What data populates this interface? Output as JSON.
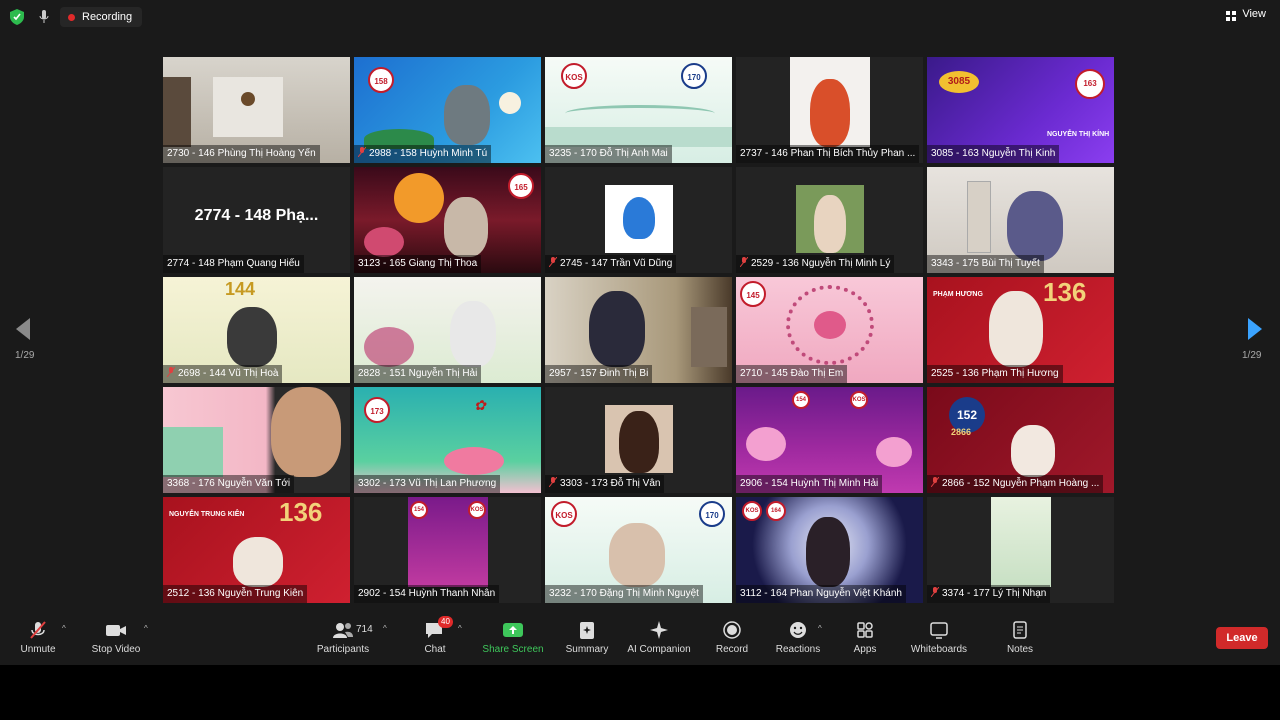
{
  "topbar": {
    "recording": "Recording",
    "view": "View"
  },
  "pager": {
    "left": "1/29",
    "right": "1/29"
  },
  "tiles": [
    {
      "label": "2730 - 146 Phùng Thị Hoàng Yến",
      "muted": false
    },
    {
      "label": "2988 - 158 Huỳnh Minh Tú",
      "muted": true
    },
    {
      "label": "3235 - 170 Đỗ Thị Anh Mai",
      "muted": false
    },
    {
      "label": "2737 - 146 Phan Thị Bích Thủy Phan ...",
      "muted": false
    },
    {
      "label": "3085 - 163 Nguyễn Thị Kinh",
      "muted": false
    },
    {
      "label": "2774 - 148 Phạm Quang Hiếu",
      "muted": false,
      "big": "2774 - 148 Phạ..."
    },
    {
      "label": "3123 - 165 Giang Thị Thoa",
      "muted": false
    },
    {
      "label": "2745 - 147 Trần Vũ Dũng",
      "muted": true
    },
    {
      "label": "2529 - 136 Nguyễn Thị Minh Lý",
      "muted": true
    },
    {
      "label": "3343 - 175 Bùi Thị Tuyết",
      "muted": false
    },
    {
      "label": "2698 - 144 Vũ Thị Hoà",
      "muted": true
    },
    {
      "label": "2828 - 151 Nguyễn Thị Hải",
      "muted": false
    },
    {
      "label": "2957 - 157 Đinh Thị Bi",
      "muted": false
    },
    {
      "label": "2710 - 145 Đào Thị Em",
      "muted": false
    },
    {
      "label": "2525 - 136 Phạm Thị Hương",
      "muted": false,
      "active": true
    },
    {
      "label": "3368 - 176 Nguyễn Văn Tới",
      "muted": false
    },
    {
      "label": "3302 - 173 Vũ Thị Lan Phương",
      "muted": false
    },
    {
      "label": "3303 - 173 Đỗ Thị Vân",
      "muted": true
    },
    {
      "label": "2906 - 154 Huỳnh Thị Minh Hải",
      "muted": false
    },
    {
      "label": "2866 - 152 Nguyễn Phạm Hoàng ...",
      "muted": true
    },
    {
      "label": "2512 - 136 Nguyễn Trung Kiên",
      "muted": false
    },
    {
      "label": "2902 - 154 Huỳnh Thanh Nhân",
      "muted": false
    },
    {
      "label": "3232 - 170 Đặng Thị Minh Nguyệt",
      "muted": false
    },
    {
      "label": "3112 - 164 Phan Nguyễn Việt Khánh",
      "muted": false
    },
    {
      "label": "3374 - 177 Lý Thị Nhạn",
      "muted": true
    }
  ],
  "tile_texts": {
    "t4_badge": "3085",
    "t4_badge2": "163",
    "t5_name": "NGUYỄN THỊ KÍNH",
    "t10_a": "144",
    "t14_a": "136",
    "t14_tag": "PHẠM HƯƠNG",
    "t19_a": "152",
    "t19_b": "2866",
    "t20_tag": "NGUYỄN TRUNG KIÊN",
    "t20_a": "136",
    "badge_158": "158",
    "badge_170": "170",
    "badge_165": "165",
    "badge_173": "173",
    "badge_145": "145",
    "badge_154": "154",
    "badge_164": "164",
    "kos": "KOS"
  },
  "toolbar": {
    "unmute": "Unmute",
    "stop_video": "Stop Video",
    "participants": "Participants",
    "participants_count": "714",
    "chat": "Chat",
    "chat_badge": "40",
    "share": "Share Screen",
    "summary": "Summary",
    "ai": "AI Companion",
    "record": "Record",
    "reactions": "Reactions",
    "apps": "Apps",
    "whiteboards": "Whiteboards",
    "notes": "Notes",
    "leave": "Leave"
  },
  "colors": {
    "accent_blue": "#3aa3ff",
    "share_green": "#3ec75b",
    "leave_red": "#d12a2a",
    "active_border": "#f2e98a"
  }
}
